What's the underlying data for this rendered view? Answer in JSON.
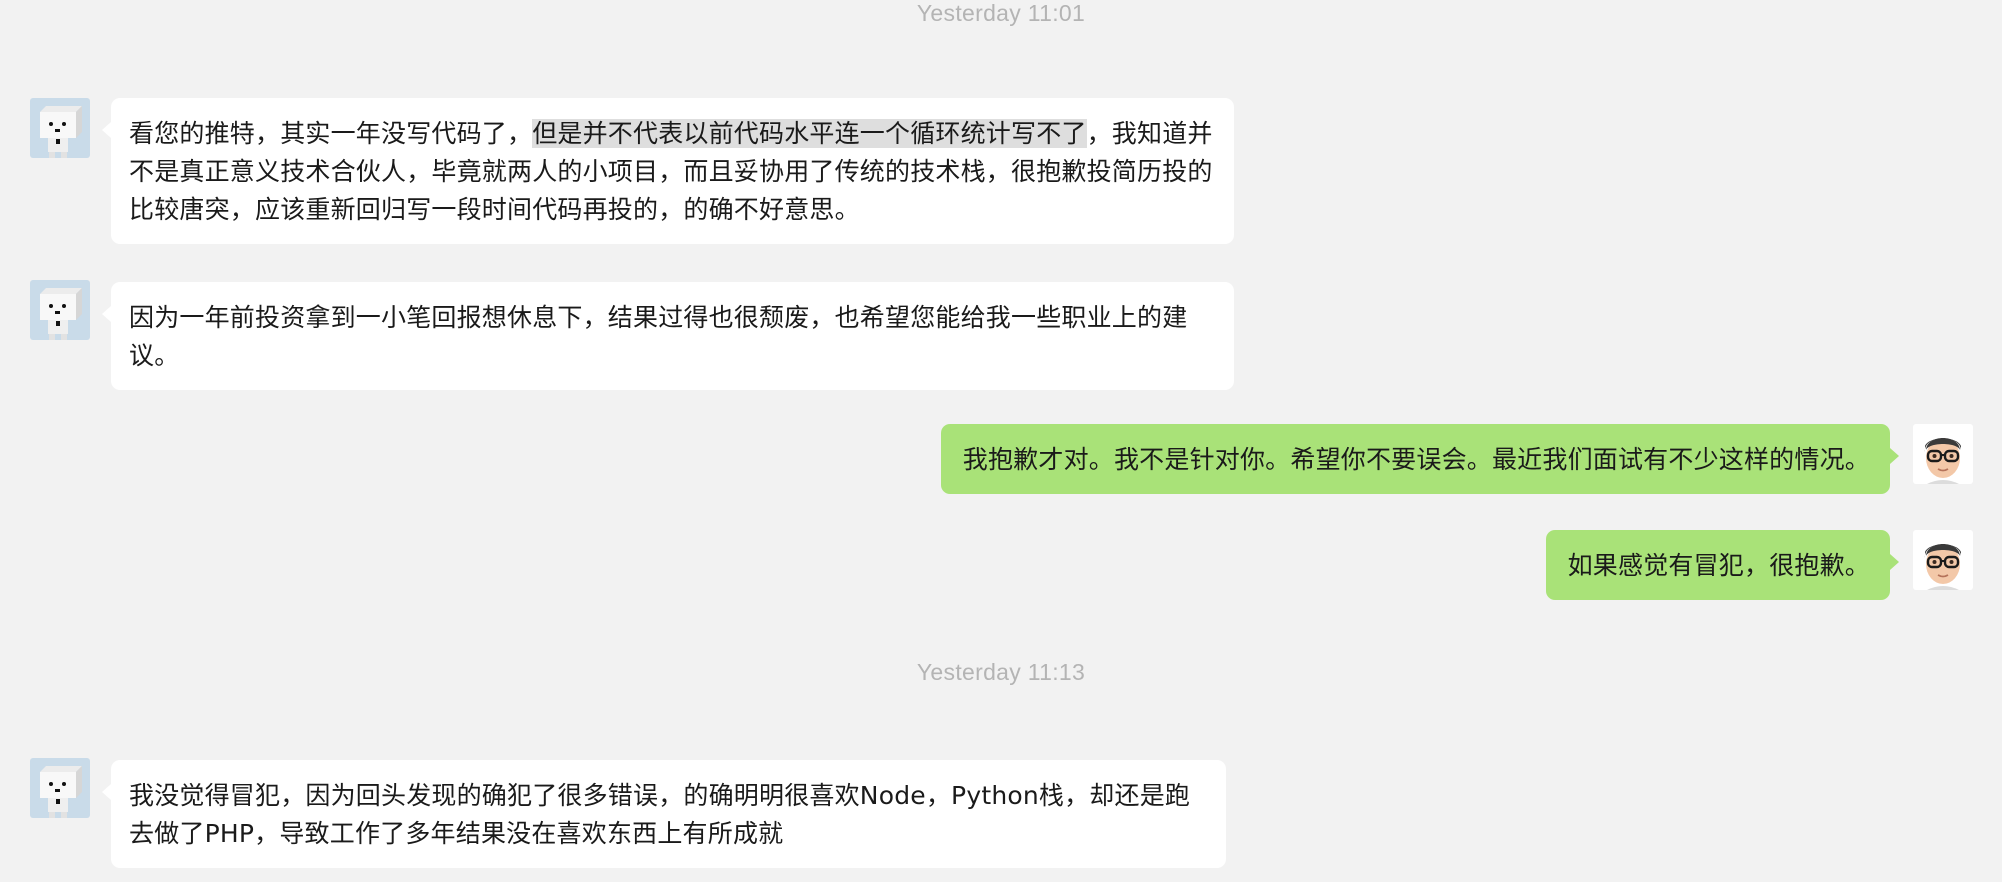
{
  "timestamps": {
    "first": "Yesterday 11:01",
    "second": "Yesterday 11:13"
  },
  "messages": [
    {
      "side": "incoming",
      "avatar": "box-robot-avatar",
      "parts": [
        "看您的推特，其实一年没写代码了，",
        "但是并不代表以前代码水平连一个循环统计写不了",
        "，我知道并不是真正意义技术合伙人，毕竟就两人的小项目，而且妥协用了传统的技术栈，很抱歉投简历投的比较唐突，应该重新回归写一段时间代码再投的，的确不好意思。"
      ]
    },
    {
      "side": "incoming",
      "avatar": "box-robot-avatar",
      "text": "因为一年前投资拿到一小笔回报想休息下，结果过得也很颓废，也希望您能给我一些职业上的建议。"
    },
    {
      "side": "outgoing",
      "avatar": "memoji-glasses-avatar",
      "text": "我抱歉才对。我不是针对你。希望你不要误会。最近我们面试有不少这样的情况。"
    },
    {
      "side": "outgoing",
      "avatar": "memoji-glasses-avatar",
      "text": "如果感觉有冒犯，很抱歉。"
    },
    {
      "side": "incoming",
      "avatar": "box-robot-avatar",
      "text": "我没觉得冒犯，因为回头发现的确犯了很多错误，的确明明很喜欢Node，Python栈，却还是跑去做了PHP，导致工作了多年结果没在喜欢东西上有所成就"
    }
  ],
  "colors": {
    "background": "#f2f2f2",
    "incoming_bubble": "#ffffff",
    "outgoing_bubble": "#a9e278",
    "timestamp_text": "#b4b4b4",
    "selection_highlight": "#dedede"
  }
}
